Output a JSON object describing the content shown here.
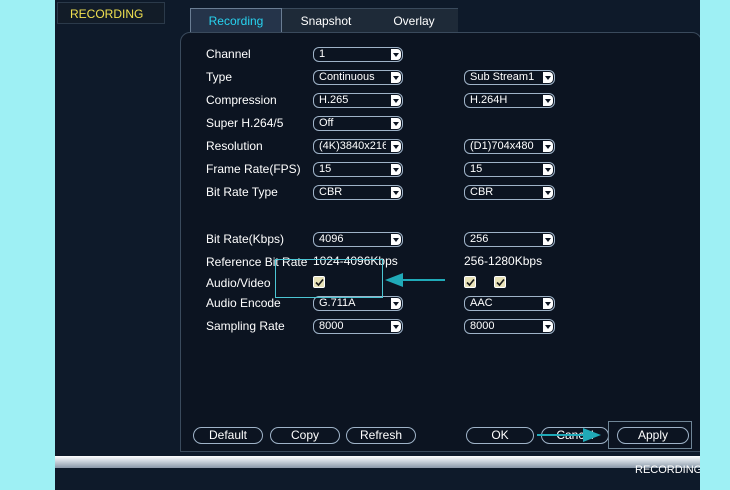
{
  "header": {
    "title": "RECORDING"
  },
  "tabs": [
    {
      "label": "Recording",
      "active": true
    },
    {
      "label": "Snapshot",
      "active": false
    },
    {
      "label": "Overlay",
      "active": false
    }
  ],
  "form": {
    "channel": {
      "label": "Channel",
      "value": "1"
    },
    "type": {
      "label": "Type",
      "main": "Continuous",
      "sub": "Sub Stream1"
    },
    "compression": {
      "label": "Compression",
      "main": "H.265",
      "sub": "H.264H"
    },
    "super_h264": {
      "label": "Super H.264/5",
      "main": "Off"
    },
    "resolution": {
      "label": "Resolution",
      "main": "(4K)3840x216",
      "sub": "(D1)704x480"
    },
    "frame_rate": {
      "label": "Frame Rate(FPS)",
      "main": "15",
      "sub": "15"
    },
    "bit_rate_type": {
      "label": "Bit Rate Type",
      "main": "CBR",
      "sub": "CBR"
    },
    "bit_rate": {
      "label": "Bit Rate(Kbps)",
      "main": "4096",
      "sub": "256"
    },
    "reference_bit_rate": {
      "label": "Reference Bit Rate",
      "main": "1024-4096Kbps",
      "sub": "256-1280Kbps"
    },
    "audio_video": {
      "label": "Audio/Video",
      "main_checked": true,
      "sub_checked_1": true,
      "sub_checked_2": true
    },
    "audio_encode": {
      "label": "Audio Encode",
      "main": "G.711A",
      "sub": "AAC"
    },
    "sampling_rate": {
      "label": "Sampling Rate",
      "main": "8000",
      "sub": "8000"
    }
  },
  "buttons": {
    "default": "Default",
    "copy": "Copy",
    "refresh": "Refresh",
    "ok": "OK",
    "cancel": "Cancel",
    "apply": "Apply"
  },
  "status_bar": {
    "text": "RECORDING"
  },
  "colors": {
    "accent": "#27d3f0",
    "title": "#f0e050",
    "annotation": "#20aab8",
    "background": "#9ef0f4"
  }
}
